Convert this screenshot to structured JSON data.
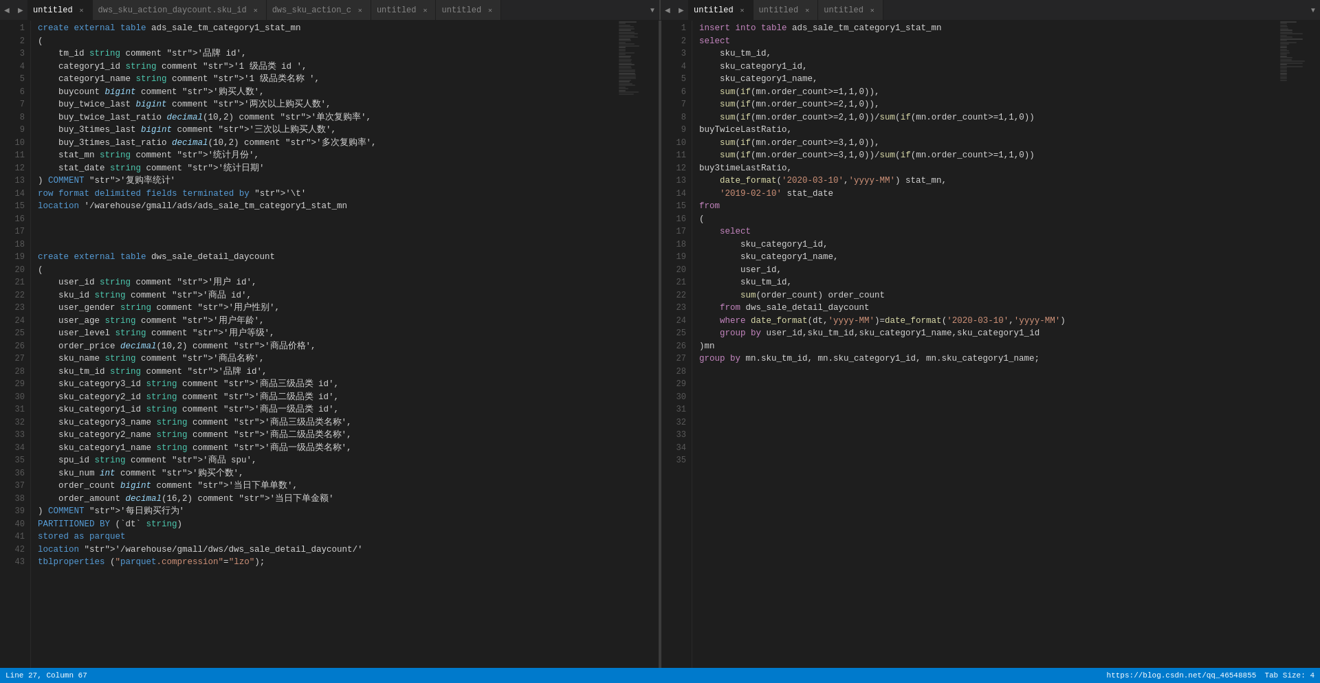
{
  "tabs_left": [
    {
      "id": "tab1",
      "label": "untitled",
      "active": true,
      "closable": true
    },
    {
      "id": "tab2",
      "label": "dws_sku_action_daycount.sku_id",
      "active": false,
      "closable": true
    },
    {
      "id": "tab3",
      "label": "dws_sku_action_c",
      "active": false,
      "closable": true
    },
    {
      "id": "tab4",
      "label": "untitled",
      "active": false,
      "closable": true
    },
    {
      "id": "tab5",
      "label": "untitled",
      "active": false,
      "closable": true
    }
  ],
  "tabs_right": [
    {
      "id": "tab6",
      "label": "untitled",
      "active": true,
      "closable": true
    },
    {
      "id": "tab7",
      "label": "untitled",
      "active": false,
      "closable": true
    },
    {
      "id": "tab8",
      "label": "untitled",
      "active": false,
      "closable": true
    }
  ],
  "status": {
    "position": "Line 27, Column 67",
    "url": "https://blog.csdn.net/qq_46548855",
    "tab_size": "Tab Size: 4"
  },
  "left_code": [
    {
      "ln": 1,
      "text": "create external table ads_sale_tm_category1_stat_mn"
    },
    {
      "ln": 2,
      "text": "("
    },
    {
      "ln": 3,
      "text": "    tm_id string comment '品牌 id',"
    },
    {
      "ln": 4,
      "text": "    category1_id string comment '1 级品类 id ',"
    },
    {
      "ln": 5,
      "text": "    category1_name string comment '1 级品类名称 ',"
    },
    {
      "ln": 6,
      "text": "    buycount bigint comment '购买人数',"
    },
    {
      "ln": 7,
      "text": "    buy_twice_last bigint comment '两次以上购买人数',"
    },
    {
      "ln": 8,
      "text": "    buy_twice_last_ratio decimal(10,2) comment '单次复购率',"
    },
    {
      "ln": 9,
      "text": "    buy_3times_last bigint comment '三次以上购买人数',"
    },
    {
      "ln": 10,
      "text": "    buy_3times_last_ratio decimal(10,2) comment '多次复购率',"
    },
    {
      "ln": 11,
      "text": "    stat_mn string comment '统计月份',"
    },
    {
      "ln": 12,
      "text": "    stat_date string comment '统计日期'"
    },
    {
      "ln": 13,
      "text": ") COMMENT '复购率统计'"
    },
    {
      "ln": 14,
      "text": "row format delimited fields terminated by '\\t'"
    },
    {
      "ln": 15,
      "text": "location '/warehouse/gmall/ads/ads_sale_tm_category1_stat_mn"
    },
    {
      "ln": 16,
      "text": ""
    },
    {
      "ln": 17,
      "text": ""
    },
    {
      "ln": 18,
      "text": ""
    },
    {
      "ln": 19,
      "text": "create external table dws_sale_detail_daycount"
    },
    {
      "ln": 20,
      "text": "("
    },
    {
      "ln": 21,
      "text": "    user_id string comment '用户 id',"
    },
    {
      "ln": 22,
      "text": "    sku_id string comment '商品 id',"
    },
    {
      "ln": 23,
      "text": "    user_gender string comment '用户性别',"
    },
    {
      "ln": 24,
      "text": "    user_age string comment '用户年龄',"
    },
    {
      "ln": 25,
      "text": "    user_level string comment '用户等级',"
    },
    {
      "ln": 26,
      "text": "    order_price decimal(10,2) comment '商品价格',"
    },
    {
      "ln": 27,
      "text": "    sku_name string comment '商品名称',"
    },
    {
      "ln": 28,
      "text": "    sku_tm_id string comment '品牌 id',"
    },
    {
      "ln": 29,
      "text": "    sku_category3_id string comment '商品三级品类 id',"
    },
    {
      "ln": 30,
      "text": "    sku_category2_id string comment '商品二级品类 id',"
    },
    {
      "ln": 31,
      "text": "    sku_category1_id string comment '商品一级品类 id',"
    },
    {
      "ln": 32,
      "text": "    sku_category3_name string comment '商品三级品类名称',"
    },
    {
      "ln": 33,
      "text": "    sku_category2_name string comment '商品二级品类名称',"
    },
    {
      "ln": 34,
      "text": "    sku_category1_name string comment '商品一级品类名称',"
    },
    {
      "ln": 35,
      "text": "    spu_id string comment '商品 spu',"
    },
    {
      "ln": 36,
      "text": "    sku_num int comment '购买个数',"
    },
    {
      "ln": 37,
      "text": "    order_count bigint comment '当日下单单数',"
    },
    {
      "ln": 38,
      "text": "    order_amount decimal(16,2) comment '当日下单金额'"
    },
    {
      "ln": 39,
      "text": ") COMMENT '每日购买行为'"
    },
    {
      "ln": 40,
      "text": "PARTITIONED BY (`dt` string)"
    },
    {
      "ln": 41,
      "text": "stored as parquet"
    },
    {
      "ln": 42,
      "text": "location '/warehouse/gmall/dws/dws_sale_detail_daycount/'"
    },
    {
      "ln": 43,
      "text": "tblproperties (\"parquet.compression\"=\"lzo\");"
    }
  ],
  "right_code": [
    {
      "ln": 1,
      "text": "insert into table ads_sale_tm_category1_stat_mn"
    },
    {
      "ln": 2,
      "text": "select"
    },
    {
      "ln": 3,
      "text": "    sku_tm_id,"
    },
    {
      "ln": 4,
      "text": "    sku_category1_id,"
    },
    {
      "ln": 5,
      "text": "    sku_category1_name,"
    },
    {
      "ln": 6,
      "text": "    sum(if(mn.order_count>=1,1,0)),"
    },
    {
      "ln": 7,
      "text": "    sum(if(mn.order_count>=2,1,0)),"
    },
    {
      "ln": 8,
      "text": "    sum(if(mn.order_count>=2,1,0))/sum(if(mn.order_count>=1,1,0))"
    },
    {
      "ln": 9,
      "text": "buyTwiceLastRatio,"
    },
    {
      "ln": 10,
      "text": "    sum(if(mn.order_count>=3,1,0)),"
    },
    {
      "ln": 11,
      "text": "    sum(if(mn.order_count>=3,1,0))/sum(if(mn.order_count>=1,1,0))"
    },
    {
      "ln": 12,
      "text": "buy3timeLastRatio,"
    },
    {
      "ln": 13,
      "text": "    date_format('2020-03-10','yyyy-MM') stat_mn,"
    },
    {
      "ln": 14,
      "text": "    '2019-02-10' stat_date"
    },
    {
      "ln": 15,
      "text": "from"
    },
    {
      "ln": 16,
      "text": "("
    },
    {
      "ln": 17,
      "text": "    select"
    },
    {
      "ln": 18,
      "text": "        sku_category1_id,"
    },
    {
      "ln": 19,
      "text": "        sku_category1_name,"
    },
    {
      "ln": 20,
      "text": "        user_id,"
    },
    {
      "ln": 21,
      "text": "        sku_tm_id,"
    },
    {
      "ln": 22,
      "text": "        sum(order_count) order_count"
    },
    {
      "ln": 23,
      "text": "    from dws_sale_detail_daycount"
    },
    {
      "ln": 24,
      "text": "    where date_format(dt,'yyyy-MM')=date_format('2020-03-10','yyyy-MM')"
    },
    {
      "ln": 25,
      "text": "    group by user_id,sku_tm_id,sku_category1_name,sku_category1_id"
    },
    {
      "ln": 26,
      "text": ")mn"
    },
    {
      "ln": 27,
      "text": "group by mn.sku_tm_id, mn.sku_category1_id, mn.sku_category1_name;"
    },
    {
      "ln": 28,
      "text": ""
    },
    {
      "ln": 29,
      "text": ""
    },
    {
      "ln": 30,
      "text": ""
    },
    {
      "ln": 31,
      "text": ""
    },
    {
      "ln": 32,
      "text": ""
    },
    {
      "ln": 33,
      "text": ""
    },
    {
      "ln": 34,
      "text": ""
    },
    {
      "ln": 35,
      "text": ""
    }
  ]
}
